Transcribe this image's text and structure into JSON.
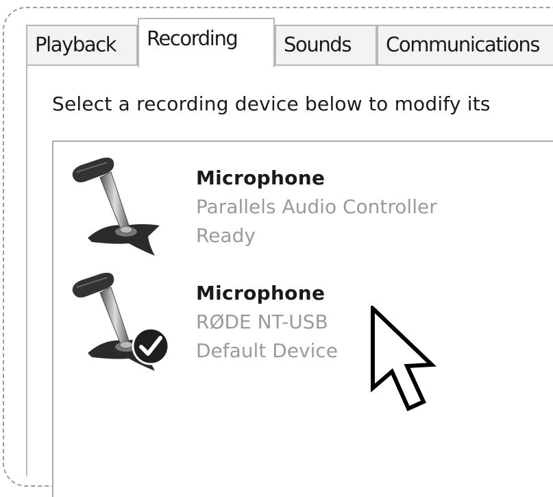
{
  "tabs": [
    {
      "label": "Playback",
      "active": false
    },
    {
      "label": "Recording",
      "active": true
    },
    {
      "label": "Sounds",
      "active": false
    },
    {
      "label": "Communications",
      "active": false
    }
  ],
  "instruction": "Select a recording device below to modify its",
  "devices": [
    {
      "name": "Microphone",
      "driver": "Parallels Audio Controller",
      "status": "Ready",
      "icon": "microphone-icon",
      "is_default": false
    },
    {
      "name": "Microphone",
      "driver": "RØDE NT-USB",
      "status": "Default Device",
      "icon": "microphone-icon",
      "is_default": true,
      "badge_icon": "checkmark-icon"
    }
  ],
  "cursor_icon": "arrow-cursor-icon"
}
